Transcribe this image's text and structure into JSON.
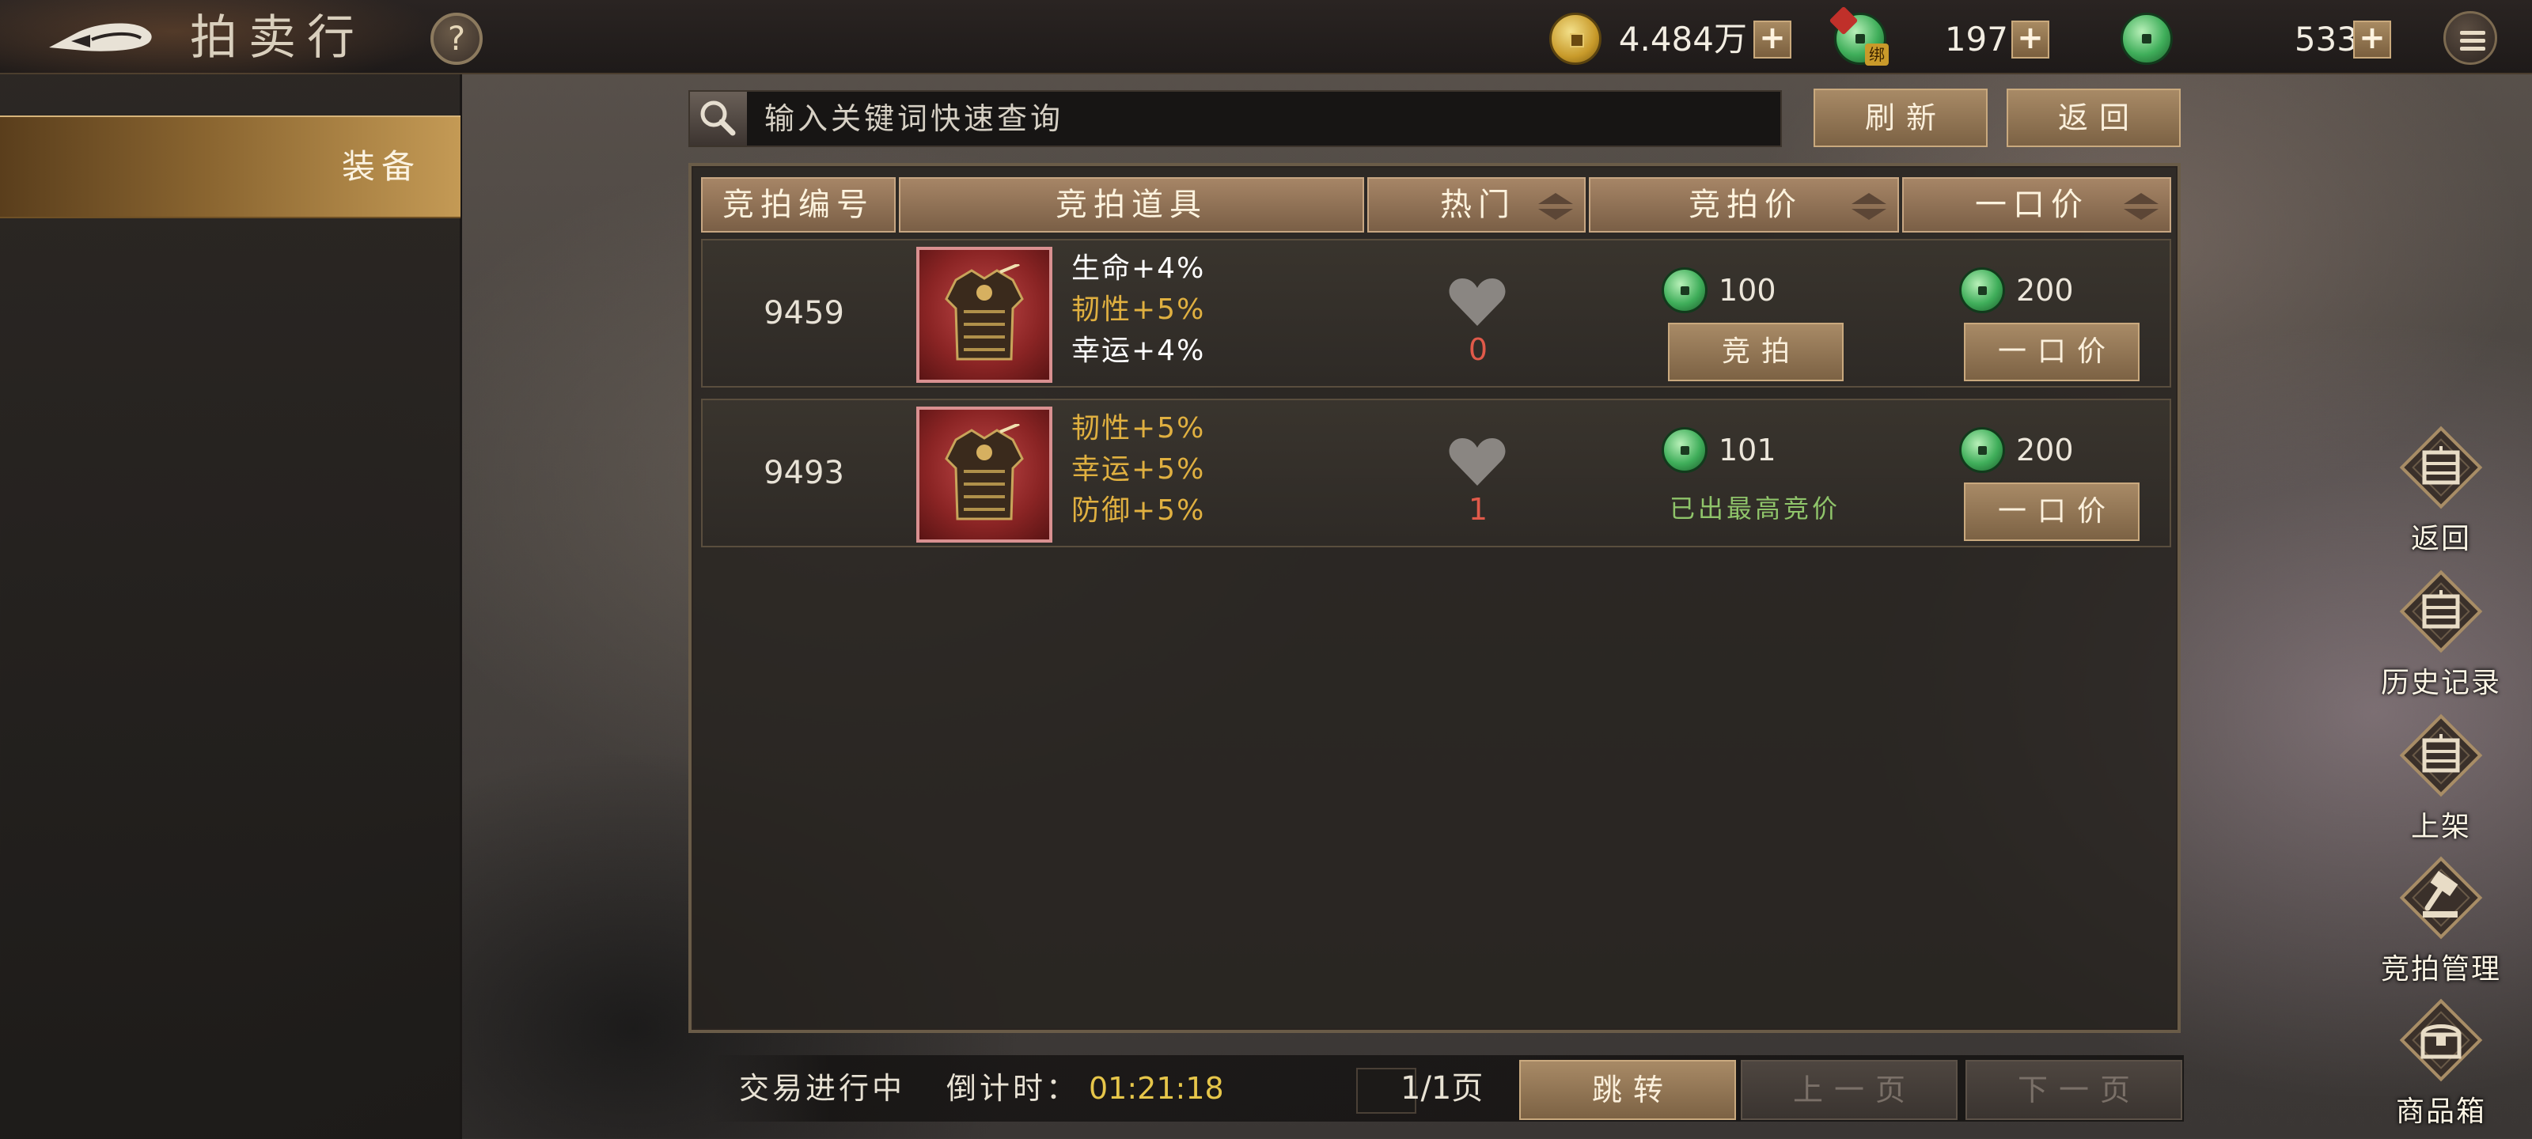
{
  "header": {
    "title": "拍卖行",
    "help_label": "?"
  },
  "currencies": {
    "copper": {
      "value": "4.484万",
      "icon": "copper-coin-icon"
    },
    "bound_jade": {
      "value": "197",
      "icon": "bound-jade-coin-icon",
      "tag": "绑"
    },
    "jade": {
      "value": "533",
      "icon": "jade-coin-icon"
    },
    "plus_label": "+"
  },
  "sidebar": {
    "items": [
      {
        "label": "装备",
        "active": true
      }
    ]
  },
  "search": {
    "placeholder": "输入关键词快速查询",
    "refresh_label": "刷新",
    "back_label": "返回"
  },
  "table": {
    "columns": {
      "id": "竞拍编号",
      "item": "竞拍道具",
      "hot": "热门",
      "bid_price": "竞拍价",
      "buyout_price": "一口价"
    },
    "rows": [
      {
        "id": "9459",
        "stats": [
          {
            "text": "生命+4%",
            "color": "#ffffff"
          },
          {
            "text": "韧性+5%",
            "color": "#e0b040"
          },
          {
            "text": "幸运+4%",
            "color": "#ffffff"
          }
        ],
        "hot": "0",
        "bid_price": "100",
        "buyout_price": "200",
        "bid_action": "竞拍",
        "buyout_action": "一口价",
        "is_highest_bidder": false
      },
      {
        "id": "9493",
        "stats": [
          {
            "text": "韧性+5%",
            "color": "#e0b040"
          },
          {
            "text": "幸运+5%",
            "color": "#e0b040"
          },
          {
            "text": "防御+5%",
            "color": "#e0b040"
          }
        ],
        "hot": "1",
        "bid_price": "101",
        "buyout_price": "200",
        "bid_status": "已出最高竞价",
        "buyout_action": "一口价",
        "is_highest_bidder": true
      }
    ]
  },
  "footer": {
    "status": "交易进行中",
    "countdown_label": "倒计时：",
    "countdown_value": "01:21:18",
    "page_info": "1/1页",
    "jump_label": "跳转",
    "prev_label": "上一页",
    "next_label": "下一页"
  },
  "side_menu": [
    {
      "label": "返回",
      "icon": "return-icon"
    },
    {
      "label": "历史记录",
      "icon": "history-icon"
    },
    {
      "label": "上架",
      "icon": "list-item-icon"
    },
    {
      "label": "竞拍管理",
      "icon": "auction-hammer-icon"
    },
    {
      "label": "商品箱",
      "icon": "goods-chest-icon"
    }
  ],
  "colors": {
    "accent_gold": "#c49a55",
    "hot_red": "#e05a4a",
    "stat_gold": "#e0b040",
    "highest_bid_green": "#8fc46a",
    "countdown_yellow": "#e6c64a"
  }
}
